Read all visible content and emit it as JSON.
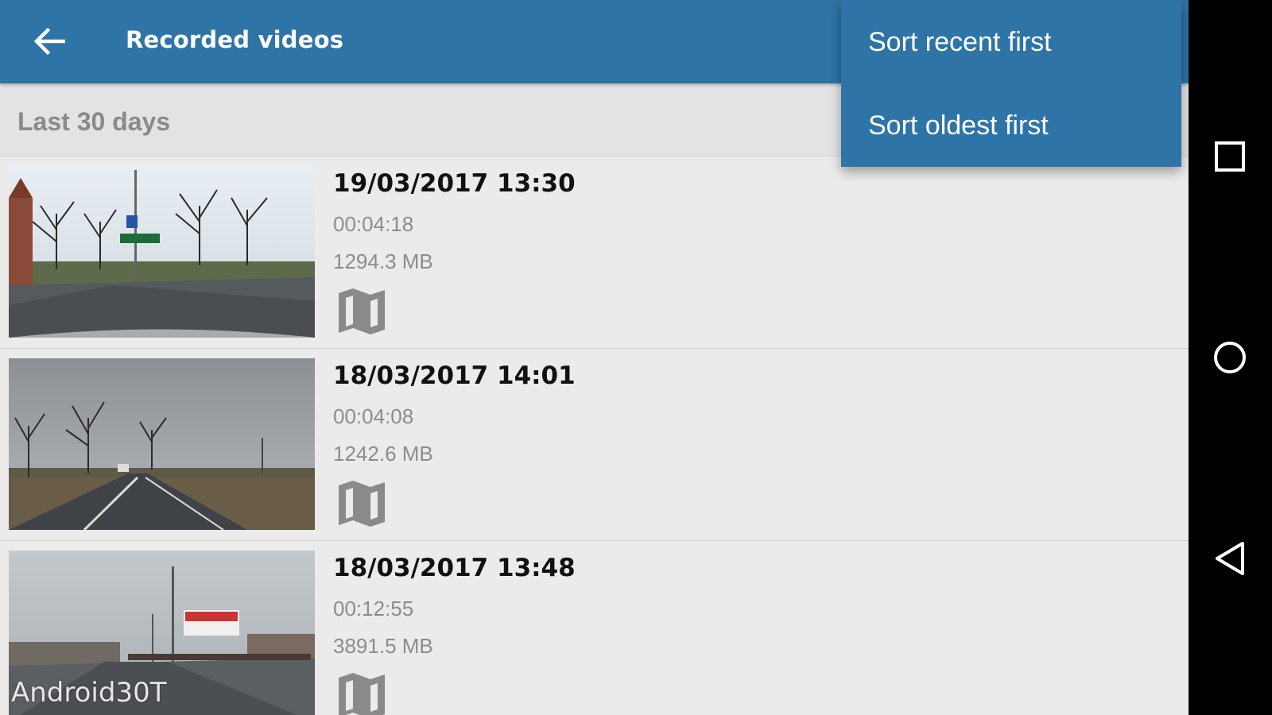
{
  "toolbar": {
    "title": "Recorded videos",
    "back_icon": "arrow-left-icon"
  },
  "section": {
    "title": "Last 30 days"
  },
  "sort_menu": {
    "items": [
      {
        "label": "Sort recent first"
      },
      {
        "label": "Sort oldest first"
      }
    ]
  },
  "videos": [
    {
      "date": "19/03/2017 13:30",
      "duration": "00:04:18",
      "size": "1294.3 MB",
      "thumbnail": "dashcam-intersection-trees",
      "action_icon": "map-icon"
    },
    {
      "date": "18/03/2017 14:01",
      "duration": "00:04:08",
      "size": "1242.6 MB",
      "thumbnail": "dashcam-rural-road-fog",
      "action_icon": "map-icon"
    },
    {
      "date": "18/03/2017 13:48",
      "duration": "00:12:55",
      "size": "3891.5 MB",
      "thumbnail": "dashcam-wet-road-billboard",
      "action_icon": "map-icon"
    }
  ],
  "watermark": "Android30T",
  "navbar": {
    "icons": [
      "recents-square-icon",
      "home-circle-icon",
      "back-triangle-icon"
    ]
  },
  "colors": {
    "primary": "#2e74a6",
    "background": "#ebebeb",
    "secondary_text": "#8c8c8c"
  }
}
